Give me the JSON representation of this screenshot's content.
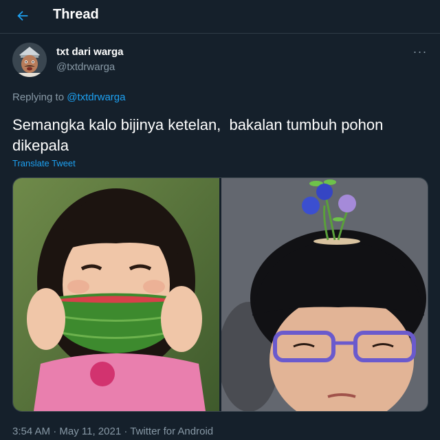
{
  "header": {
    "back_icon": "arrow-left-icon",
    "title": "Thread"
  },
  "author": {
    "name": "txt dari warga",
    "handle": "@txtdrwarga",
    "more_icon": "more-horizontal-icon",
    "more_label": "···"
  },
  "reply": {
    "prefix": "Replying to ",
    "to": "@txtdrwarga"
  },
  "tweet": {
    "text": "Semangka kalo bijinya ketelan,  bakalan tumbuh pohon dikepala",
    "translate": "Translate Tweet"
  },
  "meta": {
    "time": "3:54 AM",
    "sep1": " · ",
    "date": "May 11, 2021",
    "sep2": " · ",
    "source": "Twitter for Android"
  },
  "colors": {
    "background": "#15202b",
    "accent": "#1da1f2",
    "secondary_text": "#8899a6",
    "border": "#2f3b47"
  }
}
